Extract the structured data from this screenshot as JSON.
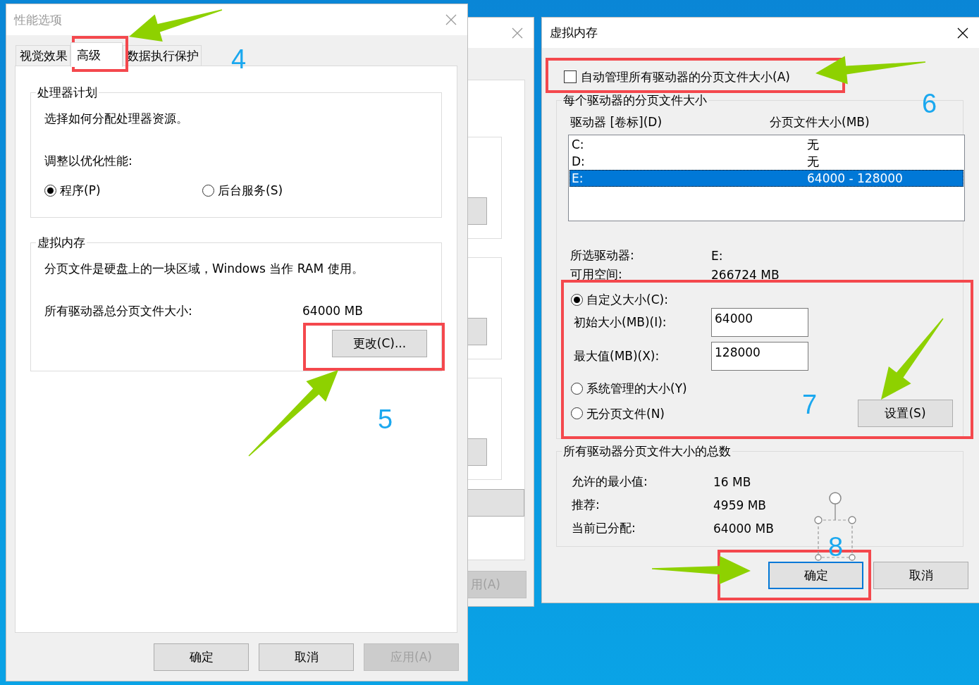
{
  "performance_window": {
    "title": "性能选项",
    "active": false,
    "tabs": [
      {
        "label": "视觉效果",
        "selected": false
      },
      {
        "label": "高级",
        "selected": true
      },
      {
        "label": "数据执行保护",
        "selected": false
      }
    ],
    "processor_group": {
      "title": "处理器计划",
      "description": "选择如何分配处理器资源。",
      "prompt": "调整以优化性能:",
      "options": [
        {
          "label": "程序(P)",
          "selected": true
        },
        {
          "label": "后台服务(S)",
          "selected": false
        }
      ]
    },
    "virtual_memory_group": {
      "title": "虚拟内存",
      "description": "分页文件是硬盘上的一块区域，Windows 当作 RAM 使用。",
      "total_label": "所有驱动器总分页文件大小:",
      "total_value": "64000 MB",
      "change_button": "更改(C)..."
    },
    "buttons": [
      {
        "label": "确定",
        "disabled": false
      },
      {
        "label": "取消",
        "disabled": false
      },
      {
        "label": "应用(A)",
        "disabled": true
      }
    ]
  },
  "background_window": {
    "apply_button": {
      "label": "用(A)",
      "disabled": true
    }
  },
  "virtual_memory_window": {
    "title": "虚拟内存",
    "active": true,
    "auto_manage": {
      "label": "自动管理所有驱动器的分页文件大小(A)",
      "checked": false
    },
    "drives_group": {
      "title": "每个驱动器的分页文件大小",
      "columns": [
        "驱动器 [卷标](D)",
        "分页文件大小(MB)"
      ],
      "rows": [
        {
          "drive": "C:",
          "size": "无",
          "selected": false
        },
        {
          "drive": "D:",
          "size": "无",
          "selected": false
        },
        {
          "drive": "E:",
          "size": "64000 - 128000",
          "selected": true
        }
      ],
      "info": [
        {
          "label": "所选驱动器:",
          "value": "E:"
        },
        {
          "label": "可用空间:",
          "value": "266724 MB"
        }
      ],
      "custom_size": {
        "label": "自定义大小(C):",
        "selected": true
      },
      "fields": [
        {
          "label": "初始大小(MB)(I):",
          "value": "64000"
        },
        {
          "label": "最大值(MB)(X):",
          "value": "128000"
        }
      ],
      "other_options": [
        {
          "label": "系统管理的大小(Y)",
          "selected": false
        },
        {
          "label": "无分页文件(N)",
          "selected": false
        }
      ],
      "set_button": "设置(S)"
    },
    "totals_group": {
      "title": "所有驱动器分页文件大小的总数",
      "rows": [
        {
          "label": "允许的最小值:",
          "value": "16 MB"
        },
        {
          "label": "推荐:",
          "value": "4959 MB"
        },
        {
          "label": "当前已分配:",
          "value": "64000 MB"
        }
      ]
    },
    "buttons": [
      {
        "label": "确定",
        "focused": true
      },
      {
        "label": "取消",
        "focused": false
      }
    ]
  },
  "step_numbers": [
    {
      "label": "4"
    },
    {
      "label": "5"
    },
    {
      "label": "6"
    },
    {
      "label": "7"
    },
    {
      "label": "8"
    }
  ]
}
